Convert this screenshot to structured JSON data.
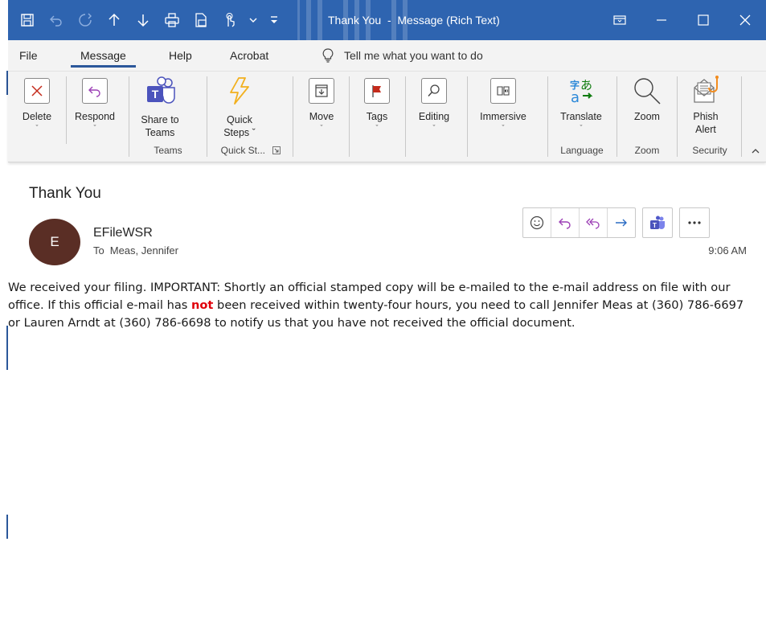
{
  "window": {
    "title": "Thank You  -  Message (Rich Text)",
    "titlebar_color": "#2e64b0",
    "quick_access": [
      "save-icon",
      "undo-icon",
      "redo-icon",
      "up-arrow-icon",
      "down-arrow-icon",
      "print-icon",
      "pdf-icon",
      "touch-mode-icon",
      "qat-more-icon",
      "customize-qat-icon"
    ],
    "controls": [
      "ribbon-display-icon",
      "minimize-icon",
      "maximize-icon",
      "close-icon"
    ]
  },
  "tabs": [
    "File",
    "Message",
    "Help",
    "Acrobat"
  ],
  "active_tab": "Message",
  "tellme": "Tell me what you want to do",
  "ribbon": {
    "delete": {
      "label": "Delete",
      "caret": "ˇ"
    },
    "respond": {
      "label": "Respond",
      "caret": "ˇ"
    },
    "share_teams": {
      "line1": "Share to",
      "line2": "Teams"
    },
    "quick_steps": {
      "line1": "Quick",
      "line2": "Steps ˇ"
    },
    "move": {
      "label": "Move",
      "caret": "ˇ"
    },
    "tags": {
      "label": "Tags",
      "caret": "ˇ"
    },
    "editing": {
      "label": "Editing",
      "caret": "ˇ"
    },
    "immersive": {
      "label": "Immersive",
      "caret": "ˇ"
    },
    "translate": {
      "label": "Translate",
      "caret": "ˇ"
    },
    "zoom": {
      "label": "Zoom"
    },
    "phish": {
      "line1": "Phish",
      "line2": "Alert"
    },
    "groups": {
      "teams": "Teams",
      "quick_steps": "Quick St...",
      "language": "Language",
      "zoom": "Zoom",
      "security": "Security"
    },
    "colors": {
      "delete_x": "#c42b1c",
      "quick_steps": "#f2b01e",
      "tags_flag": "#c42b1c",
      "teams": "#4b53bc",
      "translate_a": "#2b88d8",
      "translate_b": "#107c10"
    }
  },
  "message": {
    "subject": "Thank You",
    "avatar_initial": "E",
    "avatar_color": "#5a2e25",
    "sender": "EFileWSR",
    "to_label": "To",
    "to_value": "Meas, Jennifer",
    "time": "9:06 AM",
    "actions": [
      "emoji-icon",
      "reply-icon",
      "reply-all-icon",
      "forward-icon",
      "teams-icon",
      "more-icon"
    ],
    "body_part1": "We received your filing.  IMPORTANT:   Shortly an official stamped copy will be e-mailed to the e-mail address on file with our office.  If this official e-mail has ",
    "body_emphasis": "not",
    "body_part2": " been received within twenty-four hours, you need to call Jennifer Meas at (360) 786-6697 or Lauren Arndt at (360) 786-6698 to notify us that you have not received the official document."
  }
}
